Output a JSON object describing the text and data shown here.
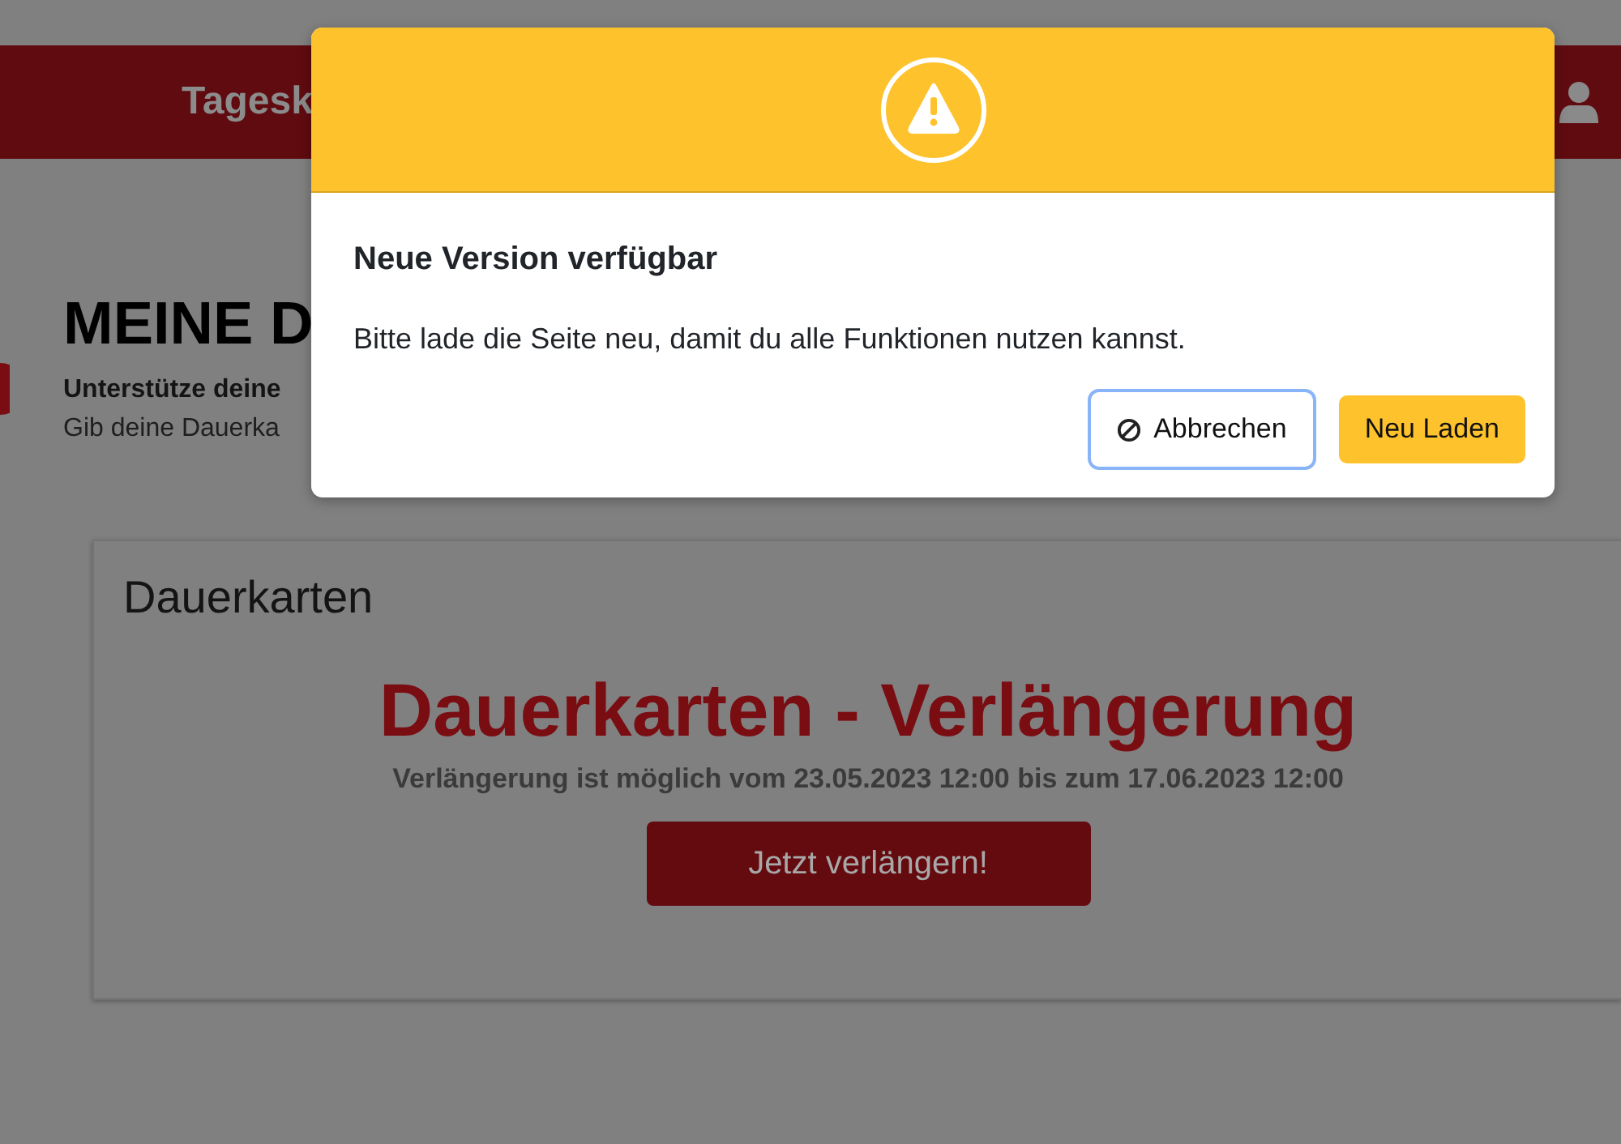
{
  "header": {
    "nav_label": "Tagesk"
  },
  "page": {
    "title": "MEINE D",
    "subtitle": "Unterstütze deine",
    "text": "Gib deine Dauerka"
  },
  "card": {
    "title": "Dauerkarten",
    "heading": "Dauerkarten - Verlängerung",
    "period": "Verlängerung ist möglich vom 23.05.2023 12:00 bis zum 17.06.2023 12:00",
    "button": "Jetzt verlängern!"
  },
  "dialog": {
    "title": "Neue Version verfügbar",
    "message": "Bitte lade die Seite neu, damit du alle Funktionen nutzen kannst.",
    "buttons": [
      {
        "label": "Abbrechen",
        "kind": "cancel",
        "focused": true
      },
      {
        "label": "Neu Laden",
        "kind": "primary",
        "focused": false
      }
    ]
  }
}
